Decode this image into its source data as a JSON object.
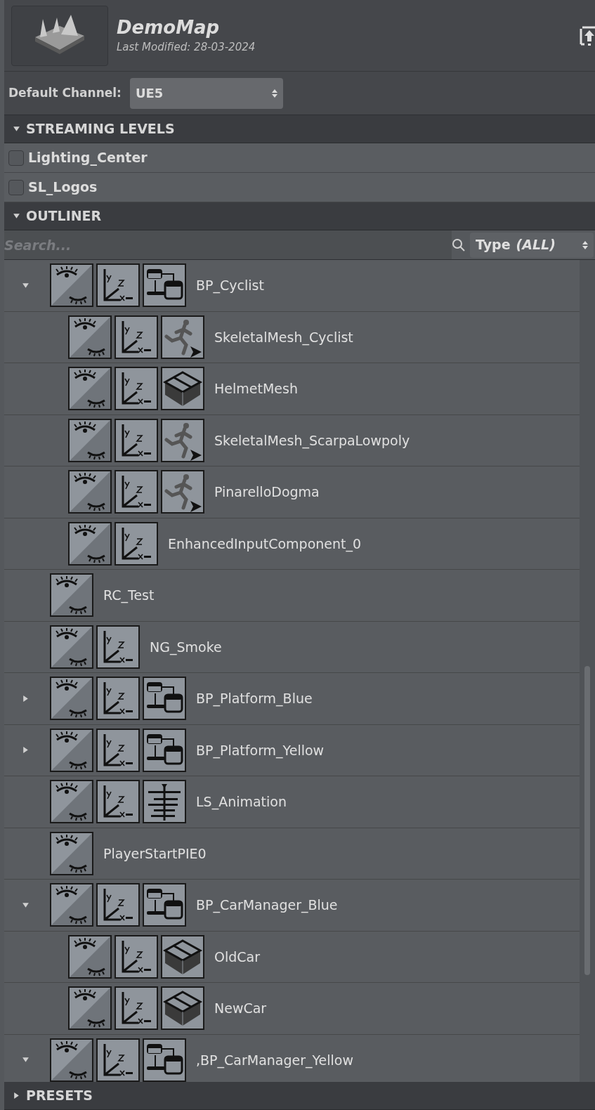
{
  "header": {
    "title": "DemoMap",
    "subtitle": "Last Modified: 28-03-2024"
  },
  "channel": {
    "label": "Default Channel:",
    "value": "UE5"
  },
  "streaming_levels": {
    "title": "STREAMING LEVELS",
    "expanded": true,
    "items": [
      {
        "label": "Lighting_Center",
        "checked": false
      },
      {
        "label": "SL_Logos",
        "checked": false
      }
    ]
  },
  "outliner": {
    "title": "OUTLINER",
    "expanded": true,
    "search": {
      "placeholder": "Search..."
    },
    "type_filter": {
      "label": "Type",
      "value": "(ALL)"
    },
    "items": [
      {
        "label": "BP_Cyclist",
        "kind": "blueprint",
        "expanded": true,
        "children": [
          {
            "label": "SkeletalMesh_Cyclist",
            "kind": "skeletal_mesh"
          },
          {
            "label": "HelmetMesh",
            "kind": "static_mesh"
          },
          {
            "label": "SkeletalMesh_ScarpaLowpoly",
            "kind": "skeletal_mesh"
          },
          {
            "label": "PinarelloDogma",
            "kind": "skeletal_mesh"
          },
          {
            "label": "EnhancedInputComponent_0",
            "kind": "component"
          }
        ]
      },
      {
        "label": "RC_Test",
        "kind": "actor"
      },
      {
        "label": "NG_Smoke",
        "kind": "component"
      },
      {
        "label": "BP_Platform_Blue",
        "kind": "blueprint",
        "expanded": false
      },
      {
        "label": "BP_Platform_Yellow",
        "kind": "blueprint",
        "expanded": false
      },
      {
        "label": "LS_Animation",
        "kind": "sequence"
      },
      {
        "label": "PlayerStartPIE0",
        "kind": "actor"
      },
      {
        "label": "BP_CarManager_Blue",
        "kind": "blueprint",
        "expanded": true,
        "children": [
          {
            "label": "OldCar",
            "kind": "static_mesh"
          },
          {
            "label": "NewCar",
            "kind": "static_mesh"
          }
        ]
      },
      {
        "label": ",BP_CarManager_Yellow",
        "kind": "blueprint",
        "expanded": true
      }
    ]
  },
  "presets": {
    "title": "PRESETS",
    "expanded": false
  }
}
